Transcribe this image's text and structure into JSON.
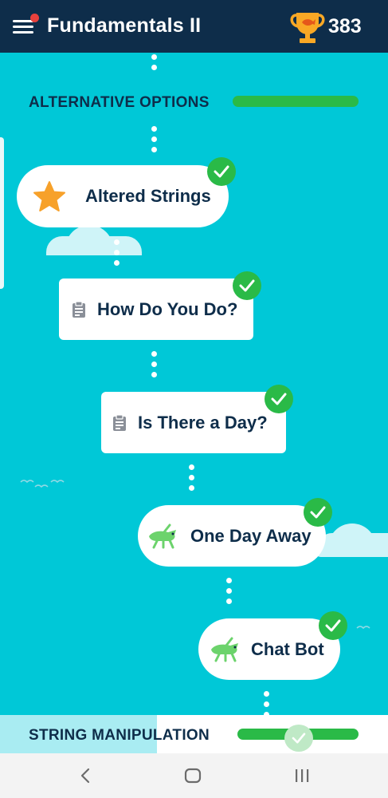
{
  "header": {
    "title": "Fundamentals II",
    "score": "383",
    "notification_dot_color": "#e8413d",
    "trophy_color": "#f9a825"
  },
  "sections": {
    "alternative_options": {
      "title": "ALTERNATIVE OPTIONS",
      "progress_fraction": 1.0
    },
    "string_manipulation": {
      "title": "STRING MANIPULATION",
      "progress_fraction": 1.0
    }
  },
  "lessons": [
    {
      "title": "Altered Strings",
      "icon": "star-icon",
      "completed": true
    },
    {
      "title": "How Do You Do?",
      "icon": "clipboard-icon",
      "completed": true
    },
    {
      "title": "Is There a Day?",
      "icon": "clipboard-icon",
      "completed": true
    },
    {
      "title": "One Day Away",
      "icon": "grasshopper-icon",
      "completed": true
    },
    {
      "title": "Chat Bot",
      "icon": "grasshopper-icon",
      "completed": true
    }
  ],
  "colors": {
    "background": "#00c8d7",
    "header": "#0e2d4a",
    "complete_green": "#2aba47",
    "text_dark": "#0e2d4a"
  },
  "navigation": {
    "back": "back-icon",
    "home": "home-icon",
    "recents": "recents-icon"
  }
}
